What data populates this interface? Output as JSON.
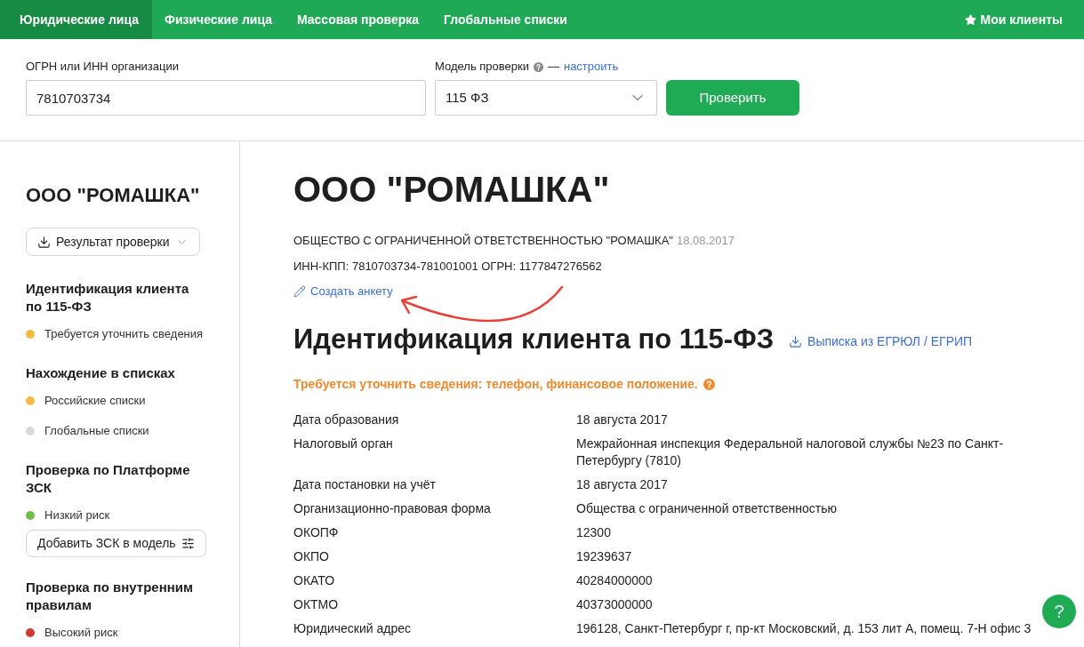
{
  "nav": {
    "tabs": [
      {
        "label": "Юридические лица",
        "selected": true
      },
      {
        "label": "Физические лица",
        "selected": false
      },
      {
        "label": "Массовая проверка",
        "selected": false
      },
      {
        "label": "Глобальные списки",
        "selected": false
      }
    ],
    "my_clients": "Мои клиенты"
  },
  "search": {
    "inn_label": "ОГРН или ИНН организации",
    "inn_value": "7810703734",
    "model_label": "Модель проверки",
    "model_separator": "—",
    "model_link": "настроить",
    "model_value": "115 ФЗ",
    "submit": "Проверить"
  },
  "sidebar": {
    "title": "ООО \"РОМАШКА\"",
    "result_button": "Результат проверки",
    "sections": [
      {
        "title": "Идентификация клиента по 115-ФЗ",
        "items": [
          {
            "label": "Требуется уточнить сведения",
            "color": "#f9b843"
          }
        ]
      },
      {
        "title": "Нахождение в списках",
        "items": [
          {
            "label": "Российские списки",
            "color": "#f9b843"
          },
          {
            "label": "Глобальные списки",
            "color": "#d9d9d9"
          }
        ]
      },
      {
        "title": "Проверка по Платформе ЗСК",
        "items": [
          {
            "label": "Низкий риск",
            "color": "#6cc04a"
          }
        ],
        "button": "Добавить ЗСК в модель"
      },
      {
        "title": "Проверка по внутренним правилам",
        "items": [
          {
            "label": "Высокий риск",
            "color": "#d13b35"
          }
        ]
      }
    ]
  },
  "company": {
    "title": "ООО \"РОМАШКА\"",
    "full_name": "ОБЩЕСТВО С ОГРАНИЧЕННОЙ ОТВЕТСТВЕННОСТЬЮ \"РОМАШКА\"",
    "registered": "18.08.2017",
    "ids": "ИНН-КПП: 7810703734-781001001 ОГРН: 1177847276562",
    "create_form_link": "Создать анкету"
  },
  "identification": {
    "title": "Идентификация клиента по 115-ФЗ",
    "extract_link": "Выписка из ЕГРЮЛ / ЕГРИП",
    "warning": "Требуется уточнить сведения: телефон, финансовое положение.",
    "rows": [
      {
        "label": "Дата образования",
        "value": "18 августа 2017"
      },
      {
        "label": "Налоговый орган",
        "value": "Межрайонная инспекция Федеральной налоговой службы №23 по Санкт-Петербургу (7810)"
      },
      {
        "label": "Дата постановки на учёт",
        "value": "18 августа 2017"
      },
      {
        "label": "Организационно-правовая форма",
        "value": "Общества с ограниченной ответственностью"
      },
      {
        "label": "ОКОПФ",
        "value": "12300"
      },
      {
        "label": "ОКПО",
        "value": "19239637"
      },
      {
        "label": "ОКАТО",
        "value": "40284000000"
      },
      {
        "label": "ОКТМО",
        "value": "40373000000"
      },
      {
        "label": "Юридический адрес",
        "value": "196128, Санкт-Петербург г, пр-кт Московский, д. 153 лит А, помещ. 7-Н офис 3"
      }
    ]
  },
  "help_button": "?"
}
